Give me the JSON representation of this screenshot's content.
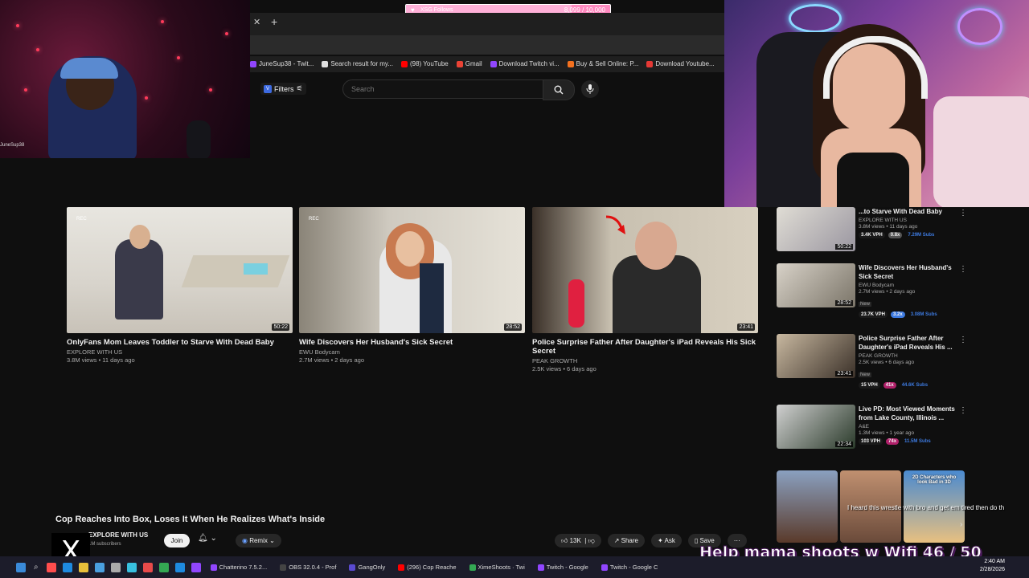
{
  "goal": {
    "label": "XSG Follows",
    "count": "8,099",
    "target": "/ 10,000",
    "progress": 0.81
  },
  "browser": {
    "close": "✕",
    "new_tab": "+",
    "bookmarks": [
      {
        "label": "JuneSup38 - Twit...",
        "color": "#9146ff"
      },
      {
        "label": "Search result for my...",
        "color": "#e0e0e0"
      },
      {
        "label": "(98) YouTube",
        "color": "#ff0000"
      },
      {
        "label": "Gmail",
        "color": "#ea4335"
      },
      {
        "label": "Download Twitch vi...",
        "color": "#9146ff"
      },
      {
        "label": "Buy & Sell Online: P...",
        "color": "#f4711f"
      },
      {
        "label": "Download Youtube...",
        "color": "#e53935"
      }
    ]
  },
  "youtube": {
    "filters_label": "Filters",
    "search_placeholder": "Search",
    "videos": [
      {
        "title": "OnlyFans Mom Leaves Toddler to Starve With Dead Baby",
        "channel": "EXPLORE WITH US",
        "meta": "3.8M views • 11 days ago",
        "duration": "50:22",
        "rec": "REC"
      },
      {
        "title": "Wife Discovers Her Husband's Sick Secret",
        "channel": "EWU Bodycam",
        "meta": "2.7M views • 2 days ago",
        "duration": "28:52",
        "rec": "REC"
      },
      {
        "title": "Police Surprise Father After Daughter's iPad Reveals His Sick Secret",
        "channel": "PEAK GROWTH",
        "meta": "2.5K views • 6 days ago",
        "duration": "23:41",
        "rec": ""
      }
    ],
    "sidebar": [
      {
        "title": "...to Starve With Dead Baby",
        "channel": "EXPLORE WITH US",
        "meta": "3.8M views • 11 days ago",
        "duration": "50:22",
        "new": "",
        "vph": "3.4K VPH",
        "mult": "0.8x",
        "subs": "7.29M Subs",
        "mult_color": "#555"
      },
      {
        "title": "Wife Discovers Her Husband's Sick Secret",
        "channel": "EWU Bodycam",
        "meta": "2.7M views • 2 days ago",
        "duration": "28:52",
        "new": "New",
        "vph": "23.7K VPH",
        "mult": "3.2x",
        "subs": "3.08M Subs",
        "mult_color": "#3d7ae0"
      },
      {
        "title": "Police Surprise Father After Daughter's iPad Reveals His ...",
        "channel": "PEAK GROWTH",
        "meta": "2.5K views • 6 days ago",
        "duration": "23:41",
        "new": "New",
        "vph": "15 VPH",
        "mult": "41x",
        "subs": "44.6K Subs",
        "mult_color": "#b0206a"
      },
      {
        "title": "Live PD: Most Viewed Moments from Lake County, Illinois ...",
        "channel": "A&E",
        "meta": "1.3M views • 1 year ago",
        "duration": "22:34",
        "new": "",
        "vph": "103 VPH",
        "mult": "74x",
        "subs": "11.5M Subs",
        "mult_color": "#b0206a"
      }
    ],
    "shorts_label": "2D Characters who look Bad in 3D",
    "main_title": "Cop Reaches Into Box, Loses It When He Realizes What's Inside",
    "channel": "EXPLORE WITH US",
    "subscribers": "1M subscribers",
    "join": "Join",
    "remix": "Remix",
    "likes": "13K",
    "share": "Share",
    "ask": "Ask",
    "save": "Save"
  },
  "overlay": {
    "goal_text": "Help mama shoots w Wifi  46 / 50",
    "chat_text": "I heard this wrestle with bro and get em tired then do th",
    "x_logo": "X"
  },
  "taskbar": {
    "apps": [
      "Chatterino 7.5.2...",
      "OBS 32.0.4 - Prof",
      "GangOnly",
      "(296) Cop Reache",
      "XimeShoots · Twi",
      "Twitch - Google",
      "Twitch - Google C"
    ],
    "time": "2:40 AM",
    "date": "2/28/2026"
  },
  "webcam": {
    "left_tag": "JuneSup38"
  }
}
